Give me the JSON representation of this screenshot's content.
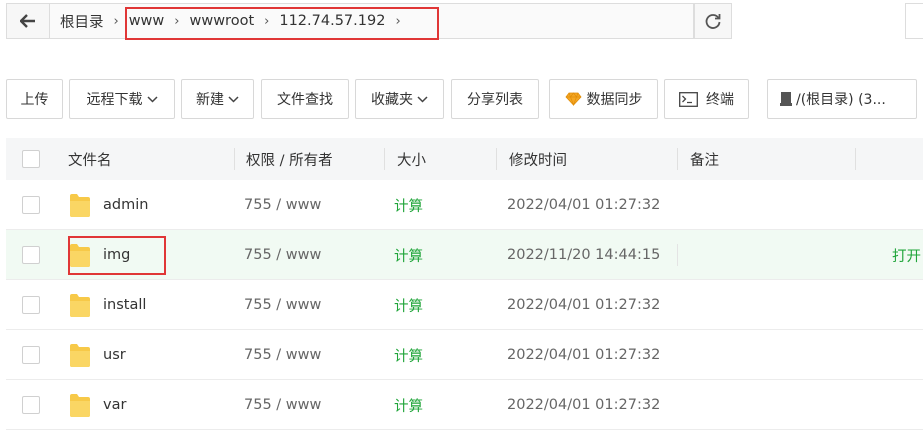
{
  "breadcrumb": {
    "root": "根目录",
    "items": [
      "www",
      "wwwroot",
      "112.74.57.192"
    ]
  },
  "toolbar": {
    "upload": "上传",
    "remote_download": "远程下载",
    "new": "新建",
    "file_search": "文件查找",
    "favorites": "收藏夹",
    "share_list": "分享列表",
    "data_sync": "数据同步",
    "terminal": "终端",
    "disk": "/(根目录) (3..."
  },
  "table": {
    "headers": {
      "name": "文件名",
      "perm": "权限 / 所有者",
      "size": "大小",
      "mtime": "修改时间",
      "note": "备注"
    },
    "rows": [
      {
        "name": "admin",
        "perm": "755 / www",
        "size": "计算",
        "mtime": "2022/04/01 01:27:32",
        "action": ""
      },
      {
        "name": "img",
        "perm": "755 / www",
        "size": "计算",
        "mtime": "2022/11/20 14:44:15",
        "action": "打开"
      },
      {
        "name": "install",
        "perm": "755 / www",
        "size": "计算",
        "mtime": "2022/04/01 01:27:32",
        "action": ""
      },
      {
        "name": "usr",
        "perm": "755 / www",
        "size": "计算",
        "mtime": "2022/04/01 01:27:32",
        "action": ""
      },
      {
        "name": "var",
        "perm": "755 / www",
        "size": "计算",
        "mtime": "2022/04/01 01:27:32",
        "action": ""
      }
    ]
  },
  "colors": {
    "accent_green": "#20a53a",
    "highlight_red": "#e03636",
    "folder_yellow": "#f7c948",
    "gem_orange": "#f5a623"
  },
  "icons": [
    "back-arrow-icon",
    "chevron-right-icon",
    "refresh-icon",
    "chevron-down-icon",
    "gem-icon",
    "terminal-icon",
    "disk-icon",
    "folder-icon"
  ]
}
